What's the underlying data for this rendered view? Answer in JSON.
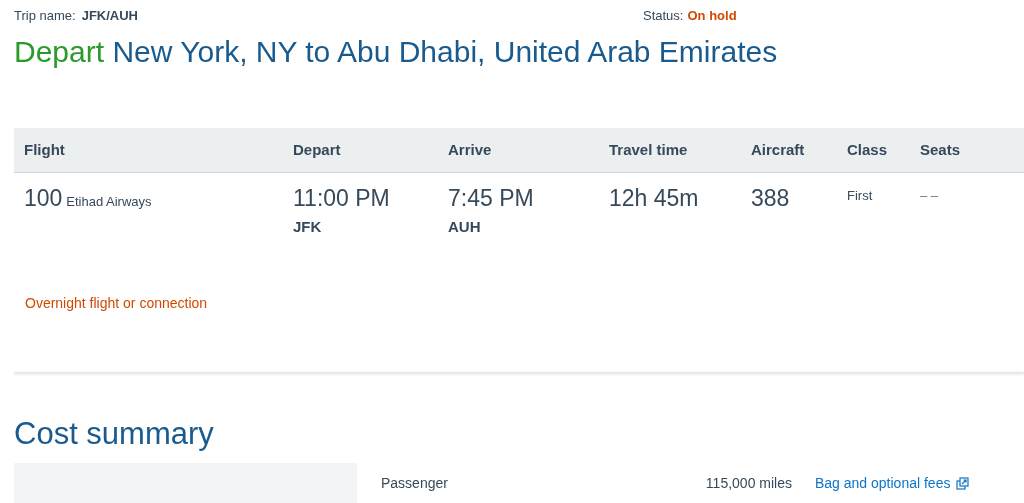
{
  "trip": {
    "label": "Trip name:",
    "value": "JFK/AUH"
  },
  "status": {
    "label": "Status:",
    "value": "On hold"
  },
  "heading": {
    "prefix": "Depart",
    "route": "New York, NY to Abu Dhabi, United Arab Emirates"
  },
  "table": {
    "columns": [
      "Flight",
      "Depart",
      "Arrive",
      "Travel time",
      "Aircraft",
      "Class",
      "Seats"
    ],
    "rows": [
      {
        "flight_number": "100",
        "airline": "Etihad Airways",
        "depart_time": "11:00 PM",
        "depart_airport": "JFK",
        "arrive_time": "7:45 PM",
        "arrive_airport": "AUH",
        "travel_time": "12h 45m",
        "aircraft": "388",
        "class": "First",
        "seats": "– –"
      }
    ]
  },
  "note": "Overnight flight or connection",
  "cost_summary": {
    "title": "Cost summary",
    "label": "Passenger",
    "amount": "115,000 miles",
    "link": "Bag and optional fees"
  }
}
